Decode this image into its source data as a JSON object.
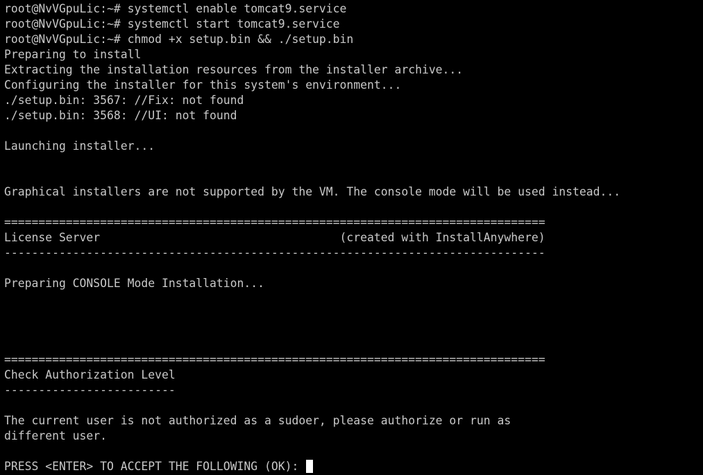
{
  "terminal": {
    "lines": [
      "root@NvVGpuLic:~# systemctl enable tomcat9.service",
      "root@NvVGpuLic:~# systemctl start tomcat9.service",
      "root@NvVGpuLic:~# chmod +x setup.bin && ./setup.bin",
      "Preparing to install",
      "Extracting the installation resources from the installer archive...",
      "Configuring the installer for this system's environment...",
      "./setup.bin: 3567: //Fix: not found",
      "./setup.bin: 3568: //UI: not found",
      "",
      "Launching installer...",
      "",
      "",
      "Graphical installers are not supported by the VM. The console mode will be used instead...",
      "",
      "===============================================================================",
      "License Server                                   (created with InstallAnywhere)",
      "-------------------------------------------------------------------------------",
      "",
      "Preparing CONSOLE Mode Installation...",
      "",
      "",
      "",
      "",
      "===============================================================================",
      "Check Authorization Level",
      "-------------------------",
      "",
      "The current user is not authorized as a sudoer, please authorize or run as",
      "different user.",
      "",
      "PRESS <ENTER> TO ACCEPT THE FOLLOWING (OK): "
    ]
  }
}
